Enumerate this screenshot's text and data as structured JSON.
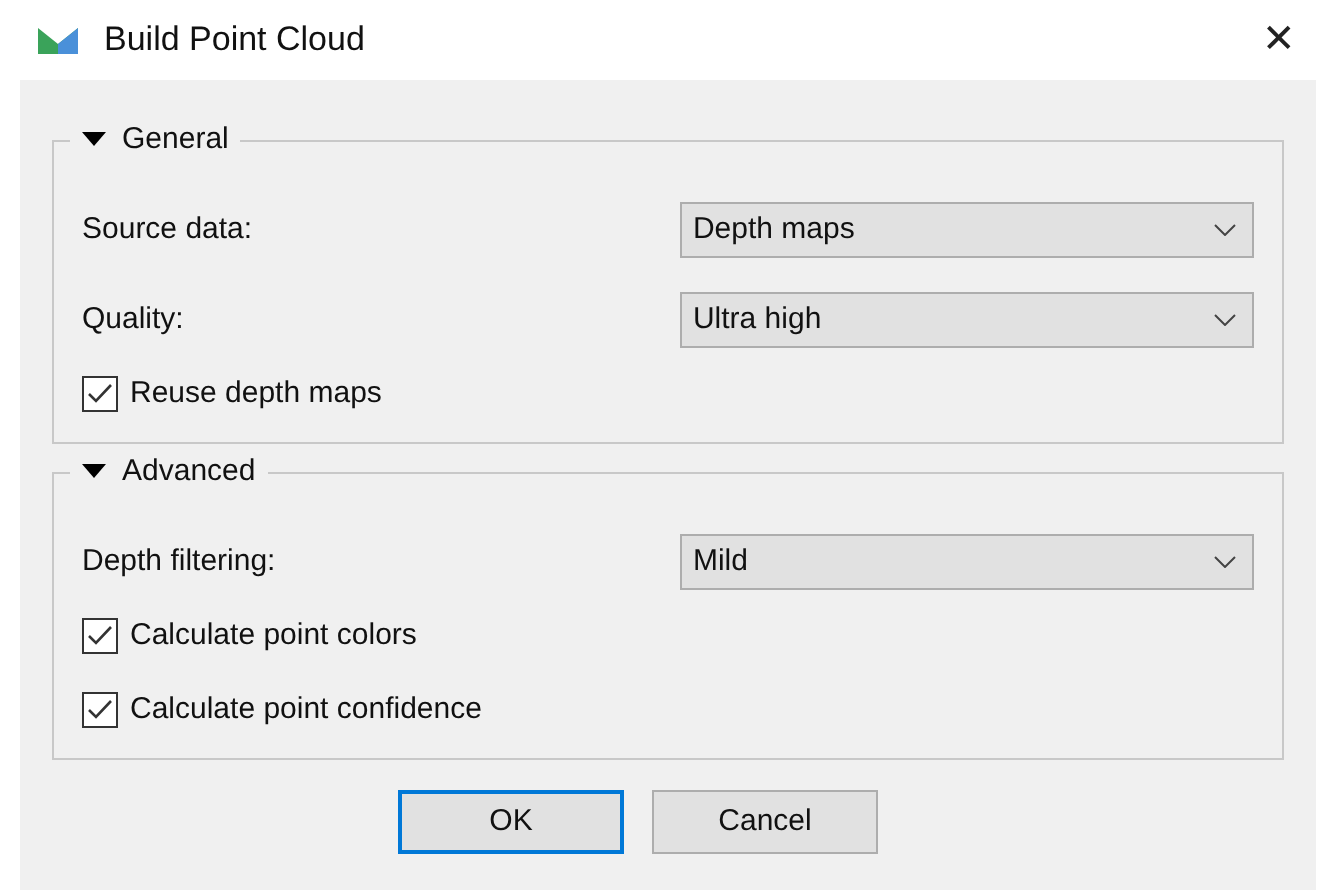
{
  "window": {
    "title": "Build Point Cloud",
    "close": "✕"
  },
  "groups": [
    {
      "title": "General",
      "expanded": true,
      "items": [
        {
          "kind": "combo",
          "label": "Source data:",
          "value": "Depth maps"
        },
        {
          "kind": "combo",
          "label": "Quality:",
          "value": "Ultra high"
        },
        {
          "kind": "checkbox",
          "label": "Reuse depth maps",
          "checked": true
        }
      ]
    },
    {
      "title": "Advanced",
      "expanded": true,
      "items": [
        {
          "kind": "combo",
          "label": "Depth filtering:",
          "value": "Mild"
        },
        {
          "kind": "checkbox",
          "label": "Calculate point colors",
          "checked": true
        },
        {
          "kind": "checkbox",
          "label": "Calculate point confidence",
          "checked": true
        }
      ]
    }
  ],
  "buttons": [
    {
      "label": "OK",
      "default": true
    },
    {
      "label": "Cancel",
      "default": false
    }
  ]
}
